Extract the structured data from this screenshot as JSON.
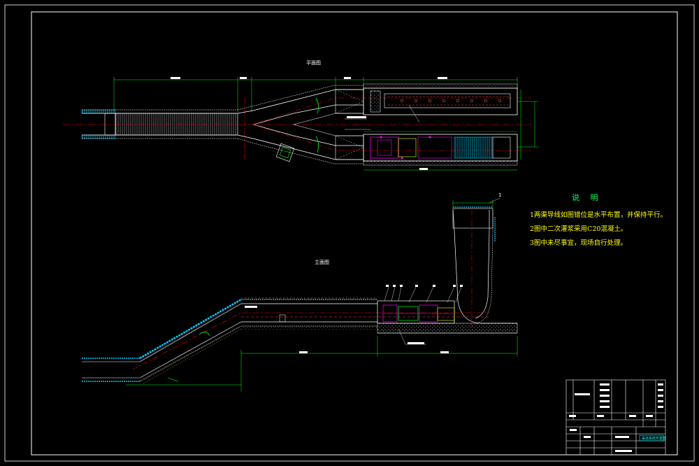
{
  "drawing": {
    "plan_view_label": "平面图",
    "elevation_view_label": "立面图",
    "callout_number": "1",
    "notes": {
      "title": "说 明",
      "items": [
        "1两渠导线如图错位是水平布置，并保持平行。",
        "2图中二次灌浆采用C20混凝土。",
        "3图中未尽事宜，现场自行处理。"
      ]
    },
    "title_block": {
      "drawing_title": "渠道系统布置图"
    },
    "colors": {
      "background": "#000000",
      "frame": "#ffffff",
      "dimension": "#00ff00",
      "centerline": "#ff0000",
      "water_hatch": "#00ffff",
      "equipment": "#ff00ff",
      "notes": "#ffff00"
    }
  }
}
